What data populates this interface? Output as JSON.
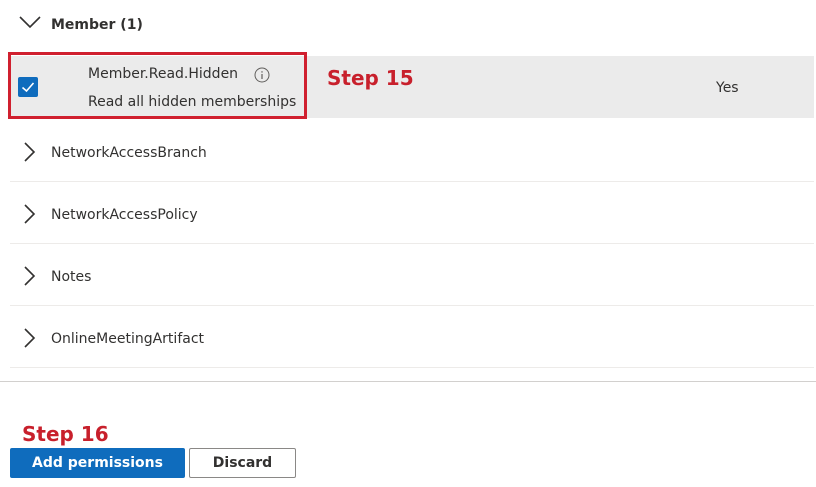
{
  "group": {
    "label": "Member (1)",
    "expanded": true
  },
  "permission": {
    "name": "Member.Read.Hidden",
    "description": "Read all hidden memberships",
    "admin_consent": "Yes",
    "checked": true,
    "info_icon": "info-icon"
  },
  "collapsed_groups": [
    {
      "label": "NetworkAccessBranch"
    },
    {
      "label": "NetworkAccessPolicy"
    },
    {
      "label": "Notes"
    },
    {
      "label": "OnlineMeetingArtifact"
    }
  ],
  "annotations": {
    "step15": "Step 15",
    "step16": "Step 16",
    "color": "#c8202c"
  },
  "actions": {
    "add_label": "Add permissions",
    "discard_label": "Discard"
  },
  "colors": {
    "accent": "#0f6cbd",
    "selected_row": "#ebebeb",
    "highlight": "#d0202f"
  }
}
